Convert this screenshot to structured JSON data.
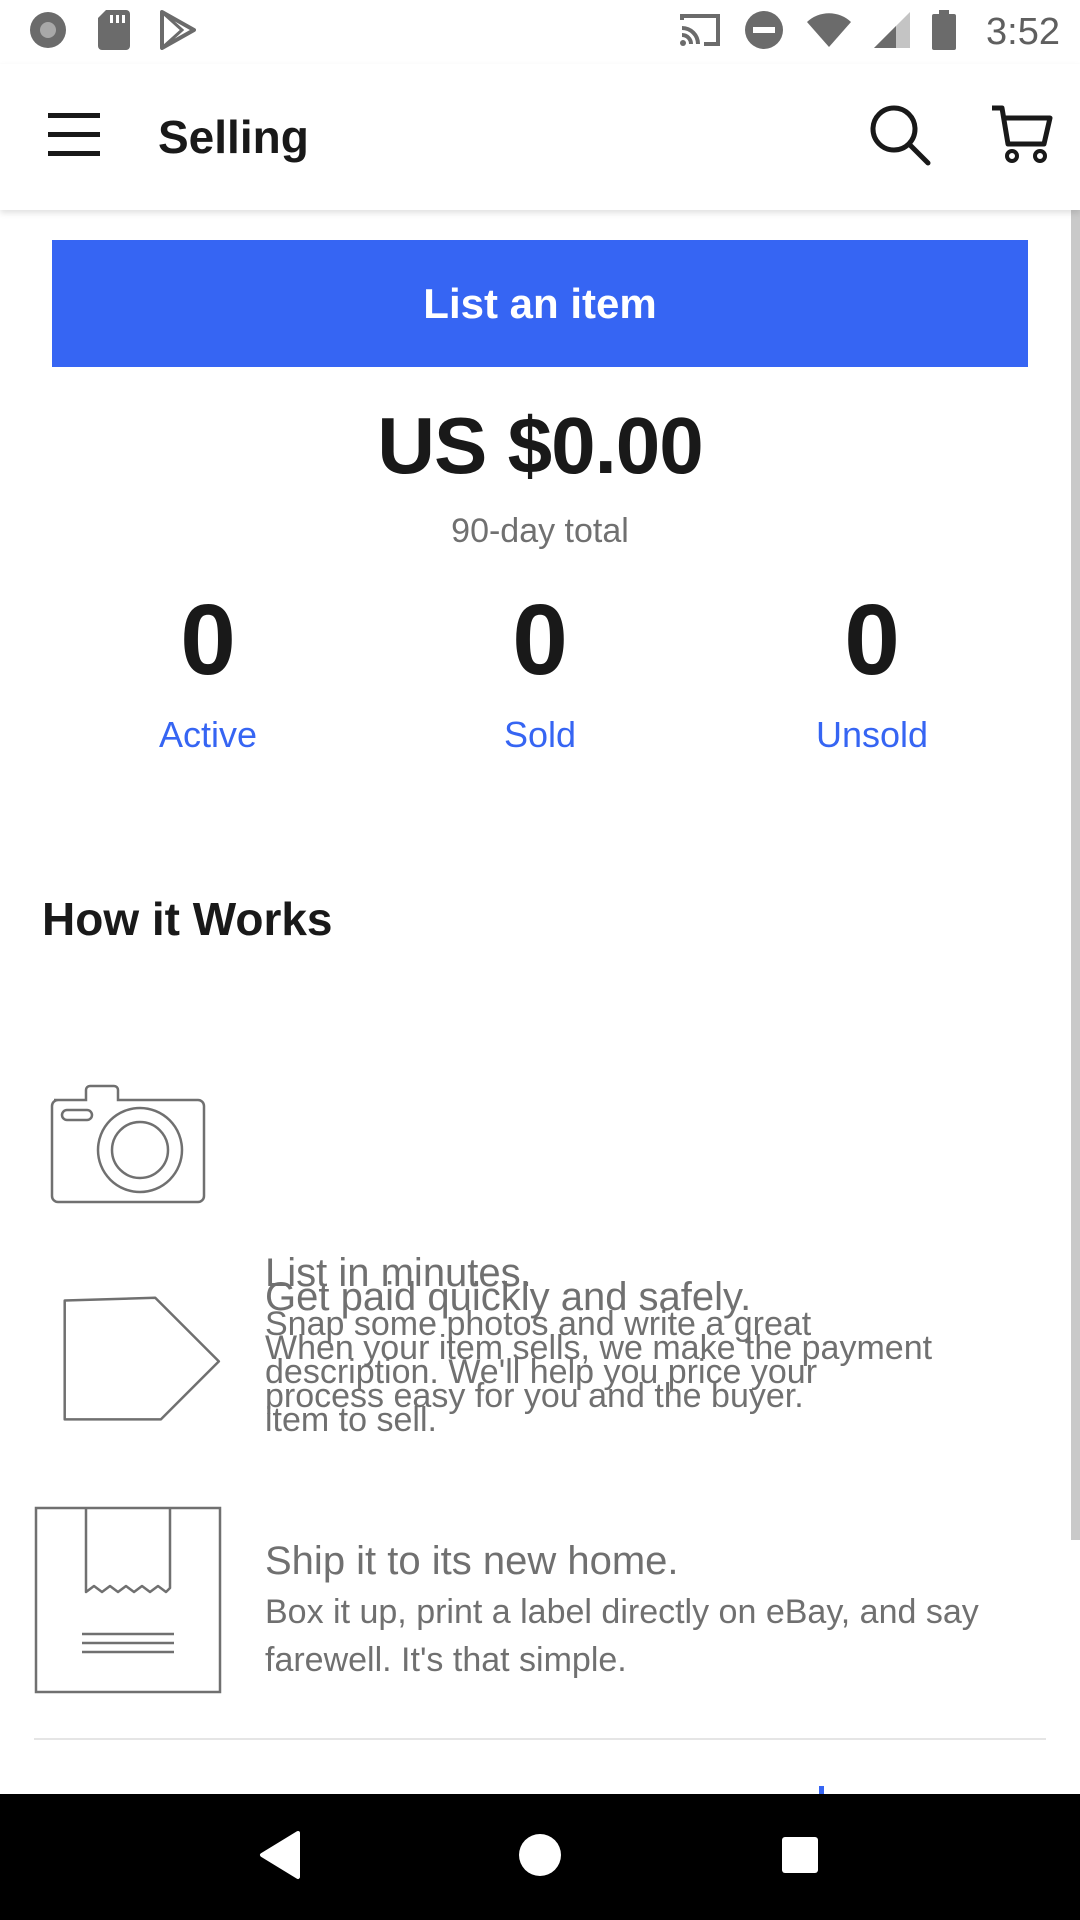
{
  "status_bar": {
    "time": "3:52",
    "left_icons": [
      "record-icon",
      "sd-card-icon",
      "play-store-icon"
    ],
    "right_icons": [
      "cast-icon",
      "do-not-disturb-icon",
      "wifi-icon",
      "signal-icon",
      "battery-icon"
    ]
  },
  "app_bar": {
    "title": "Selling",
    "icons": [
      "menu-icon",
      "search-icon",
      "cart-icon"
    ]
  },
  "list_button": {
    "label": "List an item"
  },
  "totals": {
    "amount": "US $0.00",
    "label": "90-day total"
  },
  "stats": [
    {
      "count": "0",
      "label": "Active"
    },
    {
      "count": "0",
      "label": "Sold"
    },
    {
      "count": "0",
      "label": "Unsold"
    }
  ],
  "how_it_works": {
    "title": "How it Works",
    "steps": [
      {
        "icon": "camera-icon",
        "heading": "List in minutes.",
        "body": "Snap some photos and write a great description. We'll help you price your item to sell."
      },
      {
        "icon": "price-tag-icon",
        "heading": "Get paid quickly and safely.",
        "body": "When your item sells, we make the payment process easy for you and the buyer."
      },
      {
        "icon": "shipping-box-icon",
        "heading": "Ship it to its new home.",
        "body": "Box it up, print a label directly on eBay, and say farewell. It's that simple."
      }
    ]
  },
  "nav_bar": {
    "icons": [
      "back-icon",
      "home-icon",
      "recents-icon"
    ]
  },
  "colors": {
    "accent": "#3665f3",
    "text_primary": "#191919",
    "text_secondary": "#707070",
    "nav_background": "#000000"
  }
}
